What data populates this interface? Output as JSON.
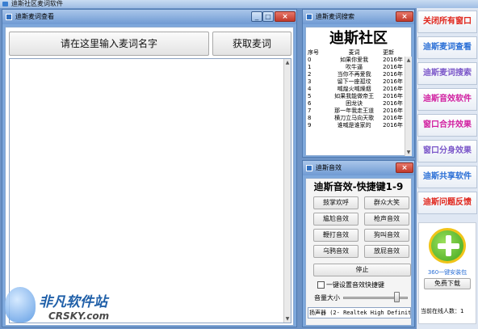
{
  "app": {
    "title": "迪斯社区麦词软件"
  },
  "colors": {
    "titlebar": "#7ea8dc",
    "close": "#c0392b",
    "red": "#e0241a",
    "blue": "#2a6fd6",
    "purple": "#7b57c9",
    "magenta": "#d11fa0"
  },
  "main_window": {
    "title": "迪斯麦词查看",
    "input_label": "请在这里输入麦词名字",
    "get_button": "获取麦词",
    "minimize": "_",
    "maximize": "□",
    "close": "×"
  },
  "search_window": {
    "title": "迪斯麦词搜索",
    "banner": "迪斯社区",
    "columns": [
      "序号",
      "麦词",
      "更新"
    ],
    "rows": [
      [
        "0",
        "如果你爱我",
        "2016年"
      ],
      [
        "1",
        "吹牛逼",
        "2016年"
      ],
      [
        "2",
        "当你不再爱我",
        "2016年"
      ],
      [
        "3",
        "留下一座孤坟",
        "2016年"
      ],
      [
        "4",
        "喊煌火喊燥烟",
        "2016年"
      ],
      [
        "5",
        "如果我能做帝王",
        "2016年"
      ],
      [
        "6",
        "困龙诀",
        "2016年"
      ],
      [
        "7",
        "那一年我走王道",
        "2016年"
      ],
      [
        "8",
        "横刀立马向天歌",
        "2016年"
      ],
      [
        "9",
        "谁喊是谁家的",
        "2016年"
      ]
    ]
  },
  "sound_window": {
    "title": "迪斯音效",
    "header": "迪斯音效-快捷键1-9",
    "buttons": [
      "鼓掌欢呼",
      "群众大笑",
      "尴尬音效",
      "枪声音效",
      "鞭打音效",
      "狗叫音效",
      "乌鸦音效",
      "放屁音效"
    ],
    "stop": "停止",
    "checkbox_label": "一键设置音效快捷键",
    "volume_label": "音量大小",
    "speaker_label": "扬声器 (2- Realtek High Definit",
    "volume_level": 0.85
  },
  "sidebar": {
    "items": [
      {
        "label": "关闭所有窗口",
        "color": "#e0241a"
      },
      {
        "label": "迪斯麦词查看",
        "color": "#2a6fd6"
      },
      {
        "label": "迪斯麦词搜索",
        "color": "#7b57c9"
      },
      {
        "label": "迪斯音效软件",
        "color": "#d11fa0"
      },
      {
        "label": "窗口合并效果",
        "color": "#d11fa0"
      },
      {
        "label": "窗口分身效果",
        "color": "#7b57c9"
      },
      {
        "label": "迪斯共享软件",
        "color": "#2a6fd6"
      },
      {
        "label": "迪斯问题反馈",
        "color": "#e0241a"
      }
    ],
    "ad_caption": "360一键安装包",
    "download_button": "免费下载",
    "online_label": "当前在线人数：",
    "online_count": "1"
  },
  "watermark": {
    "name": "非凡软件站",
    "domain": "CRSKY.com"
  }
}
